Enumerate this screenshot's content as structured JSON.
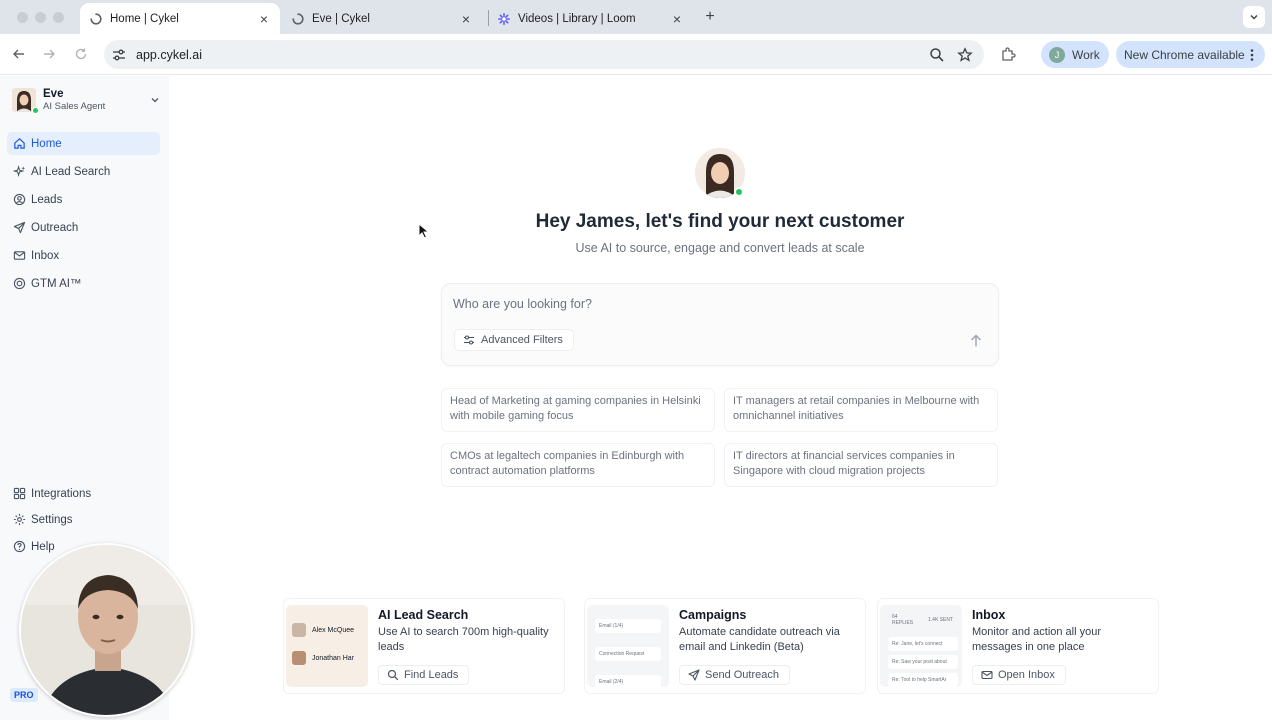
{
  "browser": {
    "tabs": [
      {
        "title": "Home | Cykel",
        "active": true
      },
      {
        "title": "Eve | Cykel",
        "active": false
      },
      {
        "title": "Videos | Library | Loom",
        "active": false
      }
    ],
    "url": "app.cykel.ai",
    "profile_initial": "J",
    "profile_label": "Work",
    "update_label": "New Chrome available"
  },
  "sidebar": {
    "agent_name": "Eve",
    "agent_role": "AI Sales Agent",
    "nav": [
      {
        "label": "Home",
        "icon": "home-icon"
      },
      {
        "label": "AI Lead Search",
        "icon": "sparkle-icon"
      },
      {
        "label": "Leads",
        "icon": "user-circle-icon"
      },
      {
        "label": "Outreach",
        "icon": "send-icon"
      },
      {
        "label": "Inbox",
        "icon": "mail-icon"
      },
      {
        "label": "GTM AI™",
        "icon": "target-icon"
      }
    ],
    "bottom_nav": [
      {
        "label": "Integrations",
        "icon": "grid-icon"
      },
      {
        "label": "Settings",
        "icon": "gear-icon"
      },
      {
        "label": "Help",
        "icon": "help-icon"
      }
    ],
    "badge": "PRO"
  },
  "main": {
    "headline": "Hey James, let's find your next customer",
    "subline": "Use AI to source, engage and convert leads at scale",
    "search_placeholder": "Who are you looking for?",
    "advanced_filters": "Advanced Filters",
    "suggestions": [
      "Head of Marketing at gaming companies in Helsinki with mobile gaming focus",
      "IT managers at retail companies in Melbourne with omnichannel initiatives",
      "CMOs at legaltech companies in Edinburgh with contract automation platforms",
      "IT directors at financial services companies in Singapore with cloud migration projects"
    ],
    "features": [
      {
        "title": "AI Lead Search",
        "desc": "Use AI to search 700m high-quality leads",
        "button": "Find Leads",
        "thumb_rows": [
          "Alex McQuee",
          "Jonathan Har"
        ]
      },
      {
        "title": "Campaigns",
        "desc": "Automate candidate outreach via email and Linkedin (Beta)",
        "button": "Send Outreach",
        "thumb_rows": [
          "Email (1/4)",
          "Connection Request",
          "Email (2/4)"
        ]
      },
      {
        "title": "Inbox",
        "desc": "Monitor and action all your messages in one place",
        "button": "Open Inbox",
        "thumb_rows": [
          "64 REPLIES",
          "1.4K SENT",
          "Re: Jane, let's connect",
          "Re: Saw your post about",
          "Re: Tool to help SmartAr"
        ]
      }
    ]
  },
  "colors": {
    "accent": "#1d5bd8",
    "active_bg": "#e4eefd",
    "online": "#22c55e"
  }
}
